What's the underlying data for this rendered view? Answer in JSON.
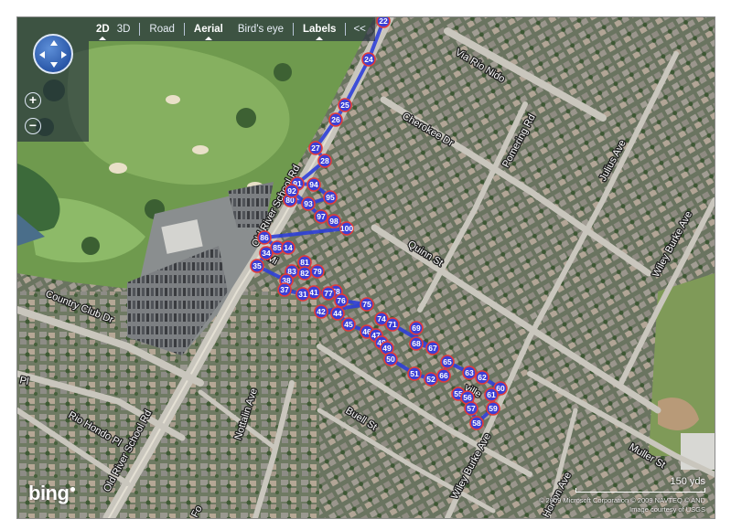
{
  "toolbar": {
    "items": [
      {
        "label": "2D",
        "active": true
      },
      {
        "label": "3D",
        "active": false
      },
      {
        "label": "Road",
        "active": false
      },
      {
        "label": "Aerial",
        "active": true
      },
      {
        "label": "Bird's eye",
        "active": false
      },
      {
        "label": "Labels",
        "active": true
      },
      {
        "label": "<<",
        "active": false
      }
    ]
  },
  "nav": {
    "zoom_in": "+",
    "zoom_out": "−"
  },
  "streets": [
    {
      "name": "Via Rio Nido"
    },
    {
      "name": "Cherokee Dr"
    },
    {
      "name": "Pomering Rd"
    },
    {
      "name": "Julius Ave"
    },
    {
      "name": "Wiley Burke Ave"
    },
    {
      "name": "Quinn St"
    },
    {
      "name": "Old River School Rd"
    },
    {
      "name": "Country Club Dr"
    },
    {
      "name": "Pl"
    },
    {
      "name": "Rio Hondo Pl"
    },
    {
      "name": "Old River School Rd"
    },
    {
      "name": "Nottalin Ave"
    },
    {
      "name": "Buell St"
    },
    {
      "name": "Wiley Burke Ave"
    },
    {
      "name": "Horton Ave"
    },
    {
      "name": "Muller St"
    },
    {
      "name": "Mi"
    },
    {
      "name": "ville"
    },
    {
      "name": "Fo"
    }
  ],
  "markers": [
    {
      "label": "22"
    },
    {
      "label": "24"
    },
    {
      "label": "25"
    },
    {
      "label": "26"
    },
    {
      "label": "27"
    },
    {
      "label": "28"
    },
    {
      "label": "91"
    },
    {
      "label": "94"
    },
    {
      "label": "93"
    },
    {
      "label": "95"
    },
    {
      "label": "80"
    },
    {
      "label": "92"
    },
    {
      "label": "97"
    },
    {
      "label": "98"
    },
    {
      "label": "100"
    },
    {
      "label": "86"
    },
    {
      "label": "85"
    },
    {
      "label": "14"
    },
    {
      "label": "34"
    },
    {
      "label": "35"
    },
    {
      "label": "81"
    },
    {
      "label": "83"
    },
    {
      "label": "82"
    },
    {
      "label": "79"
    },
    {
      "label": "38"
    },
    {
      "label": "37"
    },
    {
      "label": "41"
    },
    {
      "label": "78"
    },
    {
      "label": "77"
    },
    {
      "label": "76"
    },
    {
      "label": "75"
    },
    {
      "label": "42"
    },
    {
      "label": "44"
    },
    {
      "label": "45"
    },
    {
      "label": "74"
    },
    {
      "label": "71"
    },
    {
      "label": "69"
    },
    {
      "label": "46"
    },
    {
      "label": "47"
    },
    {
      "label": "48"
    },
    {
      "label": "68"
    },
    {
      "label": "67"
    },
    {
      "label": "49"
    },
    {
      "label": "50"
    },
    {
      "label": "65"
    },
    {
      "label": "51"
    },
    {
      "label": "52"
    },
    {
      "label": "66"
    },
    {
      "label": "63"
    },
    {
      "label": "62"
    },
    {
      "label": "60"
    },
    {
      "label": "55"
    },
    {
      "label": "56"
    },
    {
      "label": "61"
    },
    {
      "label": "57"
    },
    {
      "label": "59"
    },
    {
      "label": "58"
    },
    {
      "label": "31"
    }
  ],
  "colors": {
    "route": "#2d3fd8",
    "marker_fill": "#3b3fd6",
    "marker_ring": "#e23a3a"
  },
  "logo": "bing",
  "scale": {
    "label": "150 yds"
  },
  "copyright": {
    "line1": "© 2009 Microsoft Corporation   © 2009 NAVTEQ   © AND",
    "line2": "Image courtesy of USGS"
  }
}
